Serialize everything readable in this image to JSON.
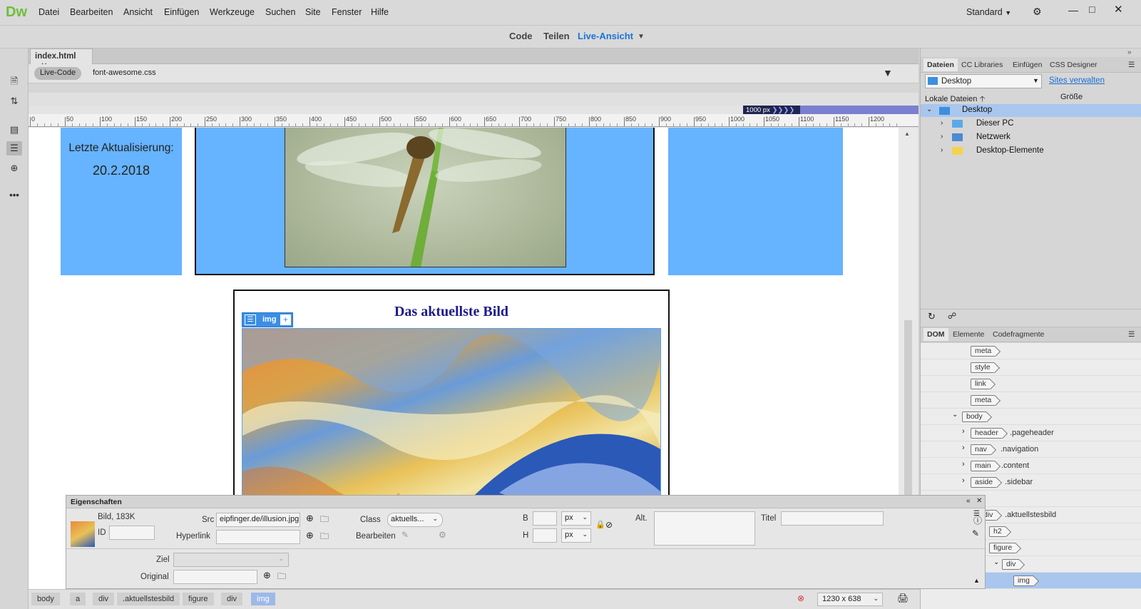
{
  "app": {
    "logo": "Dw",
    "workspace": "Standard"
  },
  "menu": [
    "Datei",
    "Bearbeiten",
    "Ansicht",
    "Einfügen",
    "Werkzeuge",
    "Suchen",
    "Site",
    "Fenster",
    "Hilfe"
  ],
  "modes": {
    "code": "Code",
    "split": "Teilen",
    "live": "Live-Ansicht"
  },
  "document": {
    "tab": "index.html",
    "live_code": "Live-Code",
    "related_file": "font-awesome.css"
  },
  "ruler": {
    "ticks": [
      "0",
      "50",
      "100",
      "150",
      "200",
      "250",
      "300",
      "350",
      "400",
      "450",
      "500",
      "550",
      "600",
      "650",
      "700",
      "750",
      "800",
      "850",
      "900",
      "950",
      "1000",
      "1050",
      "1100",
      "1150",
      "1200"
    ],
    "media_query": "1000",
    "unit": "px"
  },
  "page": {
    "last_update_label": "Letzte Aktualisierung:",
    "last_update_date": "20.2.2018",
    "section_heading": "Das aktuellste Bild",
    "element_tag": "img"
  },
  "right_panel": {
    "tabs": [
      "Dateien",
      "CC Libraries",
      "Einfügen",
      "CSS Designer"
    ],
    "site_select": "Desktop",
    "manage_sites": "Sites verwalten",
    "local_files": "Lokale Dateien",
    "size_col": "Größe",
    "tree": [
      "Desktop",
      "Dieser PC",
      "Netzwerk",
      "Desktop-Elemente"
    ],
    "lower_tabs": [
      "DOM",
      "Elemente",
      "Codefragmente"
    ],
    "dom": [
      {
        "tag": "meta",
        "cls": ""
      },
      {
        "tag": "style",
        "cls": ""
      },
      {
        "tag": "link",
        "cls": ""
      },
      {
        "tag": "meta",
        "cls": ""
      },
      {
        "tag": "body",
        "cls": ""
      },
      {
        "tag": "header",
        "cls": ".pageheader"
      },
      {
        "tag": "nav",
        "cls": ".navigation"
      },
      {
        "tag": "main",
        "cls": ".content"
      },
      {
        "tag": "aside",
        "cls": ".sidebar"
      },
      {
        "tag": "div",
        "cls": ".aktuellstesbild"
      },
      {
        "tag": "h2",
        "cls": ""
      },
      {
        "tag": "figure",
        "cls": ""
      },
      {
        "tag": "div",
        "cls": ""
      },
      {
        "tag": "img",
        "cls": ""
      }
    ]
  },
  "properties": {
    "title": "Eigenschaften",
    "info": "Bild, 183K",
    "id_label": "ID",
    "src_label": "Src",
    "src_value": "eipfinger.de/illusion.jpg",
    "hyperlink_label": "Hyperlink",
    "class_label": "Class",
    "class_value": "aktuells...",
    "edit_label": "Bearbeiten",
    "w_label": "B",
    "h_label": "H",
    "unit": "px",
    "alt_label": "Alt.",
    "title_label": "Titel",
    "target_label": "Ziel",
    "original_label": "Original"
  },
  "status": {
    "crumbs": [
      "body",
      "a",
      "div",
      ".aktuellstesbild",
      "figure",
      "div",
      "img"
    ],
    "size": "1230 x 638"
  }
}
